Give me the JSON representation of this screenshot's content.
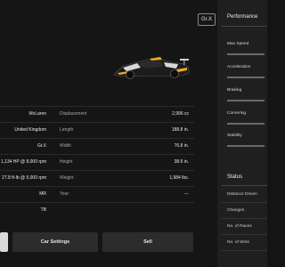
{
  "car": {
    "class_badge": "Gr.X"
  },
  "specs": [
    {
      "left_value": "McLaren",
      "right_label": "Displacement",
      "right_value": "2,996 cc"
    },
    {
      "left_value": "United Kingdom",
      "right_label": "Length",
      "right_value": "188.8 in."
    },
    {
      "left_value": "Gr.X",
      "right_label": "Width",
      "right_value": "76.8 in."
    },
    {
      "left_value": "1,134 HP @ 8,000 rpm",
      "right_label": "Height",
      "right_value": "38.9 in."
    },
    {
      "left_value": "27.8 ft-lb @ 5,000 rpm",
      "right_label": "Weight",
      "right_value": "1,984 lbs."
    },
    {
      "left_value": "MR",
      "right_label": "Year",
      "right_value": "---"
    },
    {
      "left_value": "TB",
      "right_label": "",
      "right_value": ""
    }
  ],
  "buttons": {
    "car_settings": "Car Settings",
    "sell": "Sell"
  },
  "performance": {
    "title": "Performance",
    "items": [
      {
        "label": "Max Speed"
      },
      {
        "label": "Acceleration"
      },
      {
        "label": "Braking"
      },
      {
        "label": "Cornering"
      },
      {
        "label": "Stability"
      }
    ]
  },
  "status": {
    "title": "Status",
    "items": [
      {
        "label": "Distance Driven"
      },
      {
        "label": "Changes"
      },
      {
        "label": "No. of Races"
      },
      {
        "label": "No. of Wins"
      }
    ]
  },
  "colors": {
    "accent": "#f5a623",
    "panel": "#1f1f1f"
  }
}
